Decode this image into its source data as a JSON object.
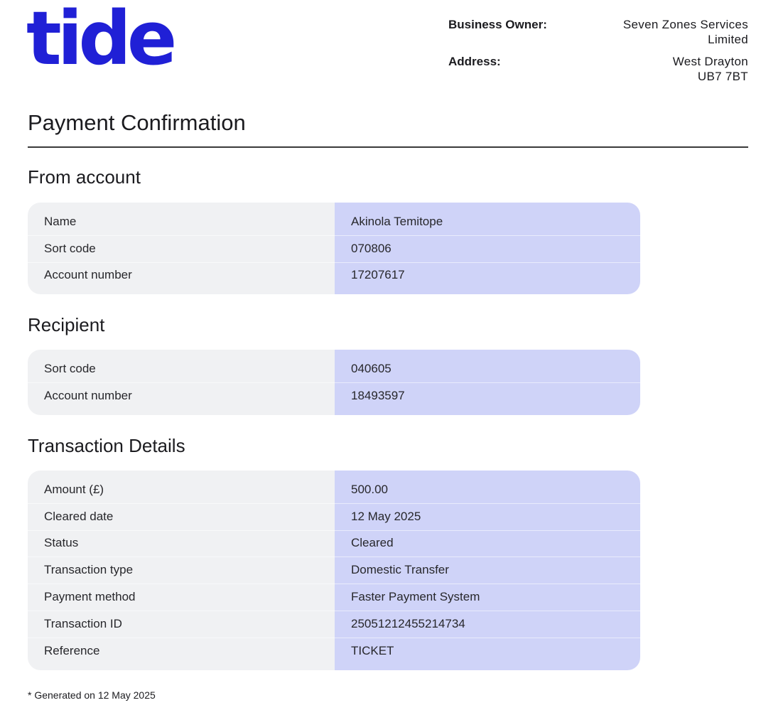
{
  "logo_text": "tide",
  "owner": {
    "business_owner_label": "Business Owner:",
    "business_owner_value": "Seven Zones Services Limited",
    "address_label": "Address:",
    "address_line1": "West Drayton",
    "address_line2": "UB7 7BT"
  },
  "page_title": "Payment Confirmation",
  "sections": {
    "from_account": {
      "title": "From account",
      "rows": [
        {
          "label": "Name",
          "value": "Akinola Temitope"
        },
        {
          "label": "Sort code",
          "value": "070806"
        },
        {
          "label": "Account number",
          "value": "17207617"
        }
      ]
    },
    "recipient": {
      "title": "Recipient",
      "rows": [
        {
          "label": "Sort code",
          "value": "040605"
        },
        {
          "label": "Account number",
          "value": "18493597"
        }
      ]
    },
    "transaction": {
      "title": "Transaction Details",
      "rows": [
        {
          "label": "Amount (£)",
          "value": "500.00"
        },
        {
          "label": "Cleared date",
          "value": "12 May 2025"
        },
        {
          "label": "Status",
          "value": "Cleared"
        },
        {
          "label": "Transaction type",
          "value": "Domestic Transfer"
        },
        {
          "label": "Payment method",
          "value": "Faster Payment System"
        },
        {
          "label": "Transaction ID",
          "value": "25051212455214734"
        },
        {
          "label": "Reference",
          "value": "TICKET"
        }
      ]
    }
  },
  "footnote": "* Generated on 12 May 2025",
  "colors": {
    "brand": "#2020d6",
    "label_column": "#f0f1f3",
    "value_column": "#cfd3f8"
  }
}
